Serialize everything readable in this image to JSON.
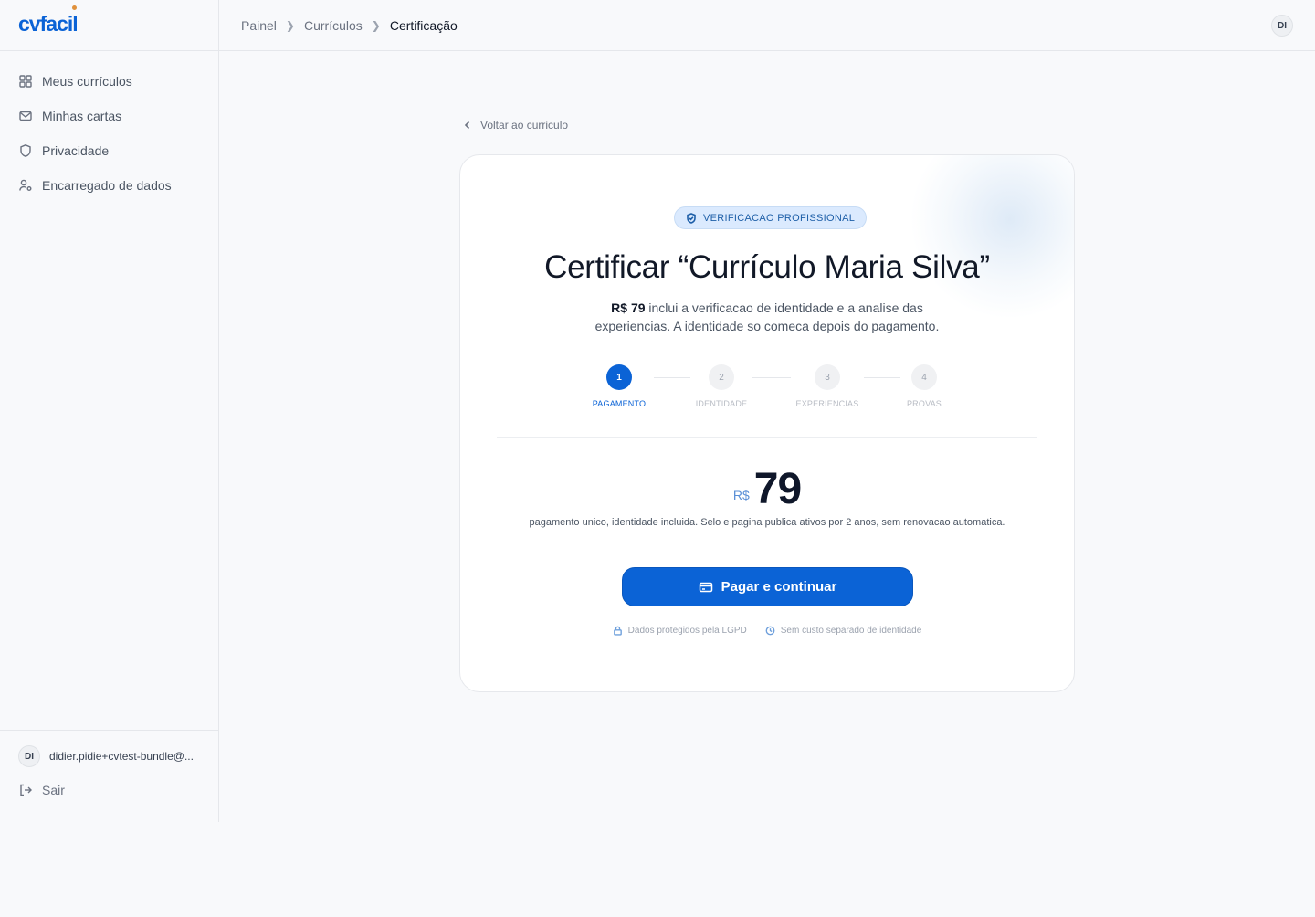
{
  "brand": {
    "name": "cvfacil"
  },
  "sidebar": {
    "items": [
      {
        "label": "Meus currículos",
        "icon": "grid-icon"
      },
      {
        "label": "Minhas cartas",
        "icon": "mail-icon"
      },
      {
        "label": "Privacidade",
        "icon": "shield-icon"
      },
      {
        "label": "Encarregado de dados",
        "icon": "user-gear-icon"
      }
    ],
    "user": {
      "initials": "DI",
      "email": "didier.pidie+cvtest-bundle@..."
    },
    "logout_label": "Sair"
  },
  "header": {
    "breadcrumbs": [
      "Painel",
      "Currículos",
      "Certificação"
    ],
    "avatar_initials": "DI"
  },
  "back_link": "Voltar ao curriculo",
  "card": {
    "badge": "VERIFICACAO PROFISSIONAL",
    "title": "Certificar “Currículo Maria Silva”",
    "desc_price": "R$ 79",
    "desc_line1": " inclui a verificacao de identidade e a analise das",
    "desc_line2": "experiencias. A identidade so comeca depois do pagamento.",
    "steps": [
      {
        "number": "1",
        "label": "PAGAMENTO",
        "active": true
      },
      {
        "number": "2",
        "label": "IDENTIDADE",
        "active": false
      },
      {
        "number": "3",
        "label": "EXPERIENCIAS",
        "active": false
      },
      {
        "number": "4",
        "label": "PROVAS",
        "active": false
      }
    ],
    "price_currency": "R$",
    "price_value": "79",
    "price_note": "pagamento unico, identidade incluida. Selo e pagina publica ativos por 2 anos, sem renovacao automatica.",
    "pay_button": "Pagar e continuar",
    "footnote_lgpd": "Dados protegidos pela LGPD",
    "footnote_cost": "Sem custo separado de identidade"
  },
  "colors": {
    "accent": "#0b63d6",
    "badge_bg": "#dbeafe",
    "logo_dot": "#e0913c"
  }
}
